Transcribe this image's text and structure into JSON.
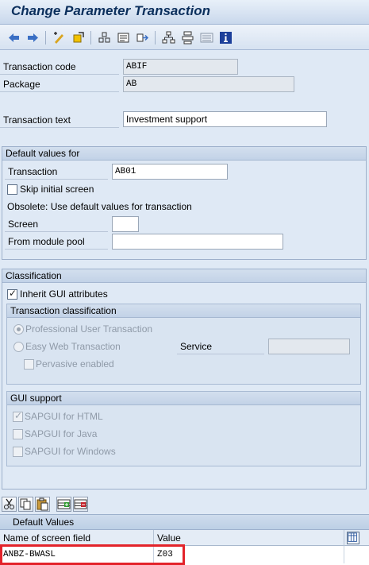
{
  "title": "Change Parameter Transaction",
  "toolbar": {
    "icons": [
      "back-arrow-icon",
      "forward-arrow-icon",
      "display-change-icon",
      "other-object-icon",
      "check-icon",
      "activate-icon",
      "where-used-icon",
      "object-list-icon",
      "navigation-window-icon",
      "display-object-list-icon",
      "info-icon"
    ]
  },
  "header": {
    "transaction_code_label": "Transaction code",
    "transaction_code_value": "ABIF",
    "package_label": "Package",
    "package_value": "AB",
    "transaction_text_label": "Transaction text",
    "transaction_text_value": "Investment support"
  },
  "defaults": {
    "group_title": "Default values for",
    "transaction_label": "Transaction",
    "transaction_value": "AB01",
    "skip_initial_label": "Skip initial screen",
    "skip_initial_checked": false,
    "obsolete_text": "Obsolete: Use default values for transaction",
    "screen_label": "Screen",
    "screen_value": "",
    "module_pool_label": "From module pool",
    "module_pool_value": ""
  },
  "classification": {
    "group_title": "Classification",
    "inherit_label": "Inherit GUI attributes",
    "inherit_checked": true,
    "tx_class_title": "Transaction classification",
    "professional_label": "Professional User Transaction",
    "professional_selected": true,
    "easy_web_label": "Easy Web Transaction",
    "easy_web_selected": false,
    "service_label": "Service",
    "service_value": "",
    "pervasive_label": "Pervasive enabled",
    "pervasive_checked": false,
    "gui_title": "GUI support",
    "html_label": "SAPGUI for HTML",
    "html_checked": true,
    "java_label": "SAPGUI for Java",
    "java_checked": false,
    "windows_label": "SAPGUI for Windows",
    "windows_checked": false
  },
  "table": {
    "title": "Default Values",
    "columns": [
      "Name of screen field",
      "Value"
    ],
    "rows": [
      {
        "field": "ANBZ-BWASL",
        "value": "Z03"
      }
    ],
    "toolbar_icons": [
      "cut-icon",
      "copy-icon",
      "paste-icon",
      "insert-row-icon",
      "delete-row-icon"
    ]
  },
  "colors": {
    "highlight": "#e3232a",
    "title_text": "#0b2f5c"
  }
}
